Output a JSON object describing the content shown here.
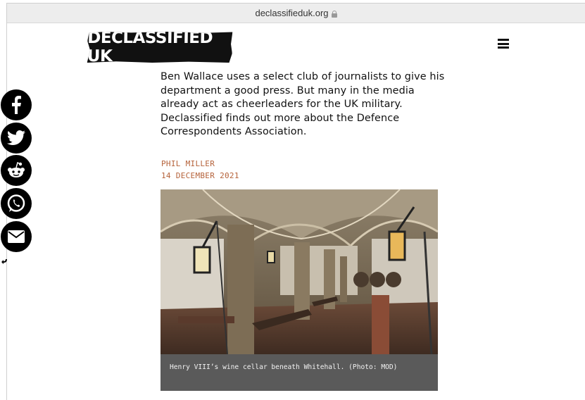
{
  "browser": {
    "url": "declassifieduk.org"
  },
  "header": {
    "logo_text": "DECLASSIFIED UK"
  },
  "article": {
    "lede": "Ben Wallace uses a select club of journalists to give his department a good press. But many in the media already act as cheerleaders for the UK military. Declassified finds out more about the Defence Correspondents Association.",
    "author": "PHIL MILLER",
    "date": "14 DECEMBER 2021",
    "image_caption": "Henry VIII’s wine cellar beneath Whitehall. (Photo: MOD)"
  },
  "share_bar": {
    "icons": [
      "facebook-icon",
      "twitter-icon",
      "reddit-icon",
      "whatsapp-icon",
      "email-icon"
    ]
  },
  "colors": {
    "accent": "#b5623a",
    "logo_bg": "#111111",
    "caption_bg": "#5a5a5a"
  }
}
